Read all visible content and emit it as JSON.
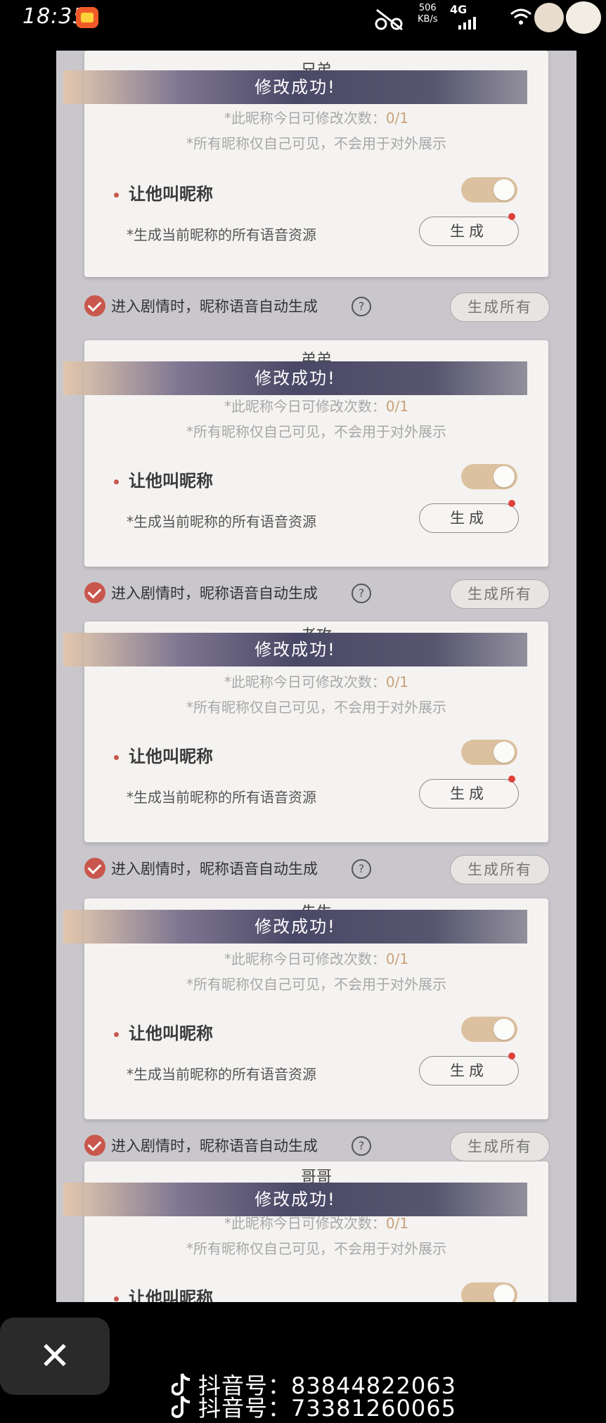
{
  "status_bar": {
    "time": "18:35",
    "net_speed_value": "506",
    "net_speed_unit": "KB/s",
    "network": "4G",
    "icons": [
      "app-icon",
      "muted-icon",
      "signal-icon",
      "wifi-icon",
      "sticker-icon",
      "sticker-icon"
    ]
  },
  "cards": [
    {
      "relation": "兄弟",
      "toast": "修改成功!",
      "limit_text": "*此昵称今日可修改次数：",
      "limit_value": "0/1",
      "privacy_text": "*所有昵称仅自己可见，不会用于对外展示",
      "nickname_label": "让他叫昵称",
      "toggle_on": true,
      "generate_desc": "*生成当前昵称的所有语音资源",
      "generate_btn": "生成",
      "auto_text": "进入剧情时，昵称语音自动生成",
      "generate_all_btn": "生成所有"
    },
    {
      "relation": "弟弟",
      "toast": "修改成功!",
      "limit_text": "*此昵称今日可修改次数：",
      "limit_value": "0/1",
      "privacy_text": "*所有昵称仅自己可见，不会用于对外展示",
      "nickname_label": "让他叫昵称",
      "toggle_on": true,
      "generate_desc": "*生成当前昵称的所有语音资源",
      "generate_btn": "生成",
      "auto_text": "进入剧情时，昵称语音自动生成",
      "generate_all_btn": "生成所有"
    },
    {
      "relation": "老攻",
      "toast": "修改成功!",
      "limit_text": "*此昵称今日可修改次数：",
      "limit_value": "0/1",
      "privacy_text": "*所有昵称仅自己可见，不会用于对外展示",
      "nickname_label": "让他叫昵称",
      "toggle_on": true,
      "generate_desc": "*生成当前昵称的所有语音资源",
      "generate_btn": "生成",
      "auto_text": "进入剧情时，昵称语音自动生成",
      "generate_all_btn": "生成所有"
    },
    {
      "relation": "先生",
      "toast": "修改成功!",
      "limit_text": "*此昵称今日可修改次数：",
      "limit_value": "0/1",
      "privacy_text": "*所有昵称仅自己可见，不会用于对外展示",
      "nickname_label": "让他叫昵称",
      "toggle_on": true,
      "generate_desc": "*生成当前昵称的所有语音资源",
      "generate_btn": "生成",
      "auto_text": "进入剧情时，昵称语音自动生成",
      "generate_all_btn": "生成所有"
    },
    {
      "relation": "哥哥",
      "toast": "修改成功!",
      "limit_text": "*此昵称今日可修改次数：",
      "limit_value": "0/1",
      "privacy_text": "*所有昵称仅自己可见，不会用于对外展示",
      "nickname_label": "让他叫昵称",
      "toggle_on": true
    }
  ],
  "bottom": {
    "close_icon": "close-icon",
    "douyin_id_1": "抖音号：83844822063",
    "douyin_id_2": "抖音号：73381260065"
  }
}
